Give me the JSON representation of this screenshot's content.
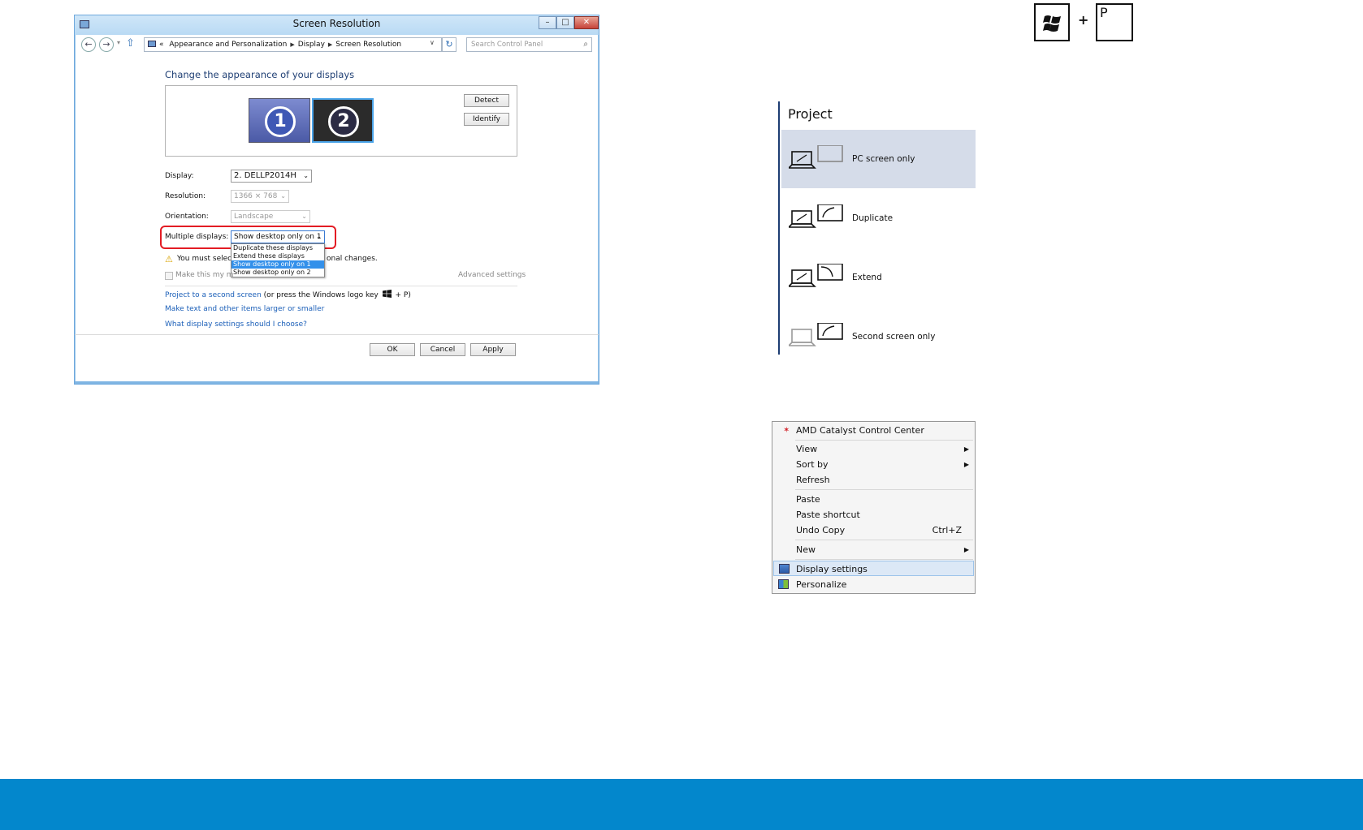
{
  "window": {
    "title": "Screen Resolution",
    "controls": {
      "minimize": "–",
      "maximize": "□",
      "close": "✕"
    },
    "address": {
      "prefix": "«",
      "crumbs": [
        "Appearance and Personalization",
        "Display",
        "Screen Resolution"
      ],
      "separator": "▶"
    },
    "search_placeholder": "Search Control Panel",
    "heading": "Change the appearance of your displays",
    "monitors": [
      "1",
      "2"
    ],
    "detect_label": "Detect",
    "identify_label": "Identify",
    "display_label": "Display:",
    "display_value": "2. DELLP2014H",
    "resolution_label": "Resolution:",
    "resolution_value": "1366 × 768",
    "orientation_label": "Orientation:",
    "orientation_value": "Landscape",
    "multiple_label": "Multiple displays:",
    "multiple_value": "Show desktop only on 1",
    "dropdown_options": [
      "Duplicate these displays",
      "Extend these displays",
      "Show desktop only on 1",
      "Show desktop only on 2"
    ],
    "warning_start": "You must select",
    "warning_end": "onal changes.",
    "checkbox_label": "Make this my m",
    "advanced_link": "Advanced settings",
    "link1_blue": "Project to a second screen",
    "link1_black_a": " (or press the Windows logo key ",
    "link1_black_b": " + P)",
    "link2": "Make text and other items larger or smaller",
    "link3": "What display settings should I choose?",
    "ok_label": "OK",
    "cancel_label": "Cancel",
    "apply_label": "Apply"
  },
  "keys": {
    "plus": "+",
    "p": "P"
  },
  "project": {
    "title": "Project",
    "items": [
      "PC screen only",
      "Duplicate",
      "Extend",
      "Second screen only"
    ],
    "active_index": 0
  },
  "context_menu": {
    "items": [
      {
        "label": "AMD Catalyst Control Center"
      },
      {
        "label": "View",
        "arrow": "▶"
      },
      {
        "label": "Sort by",
        "arrow": "▶"
      },
      {
        "label": "Refresh"
      },
      {
        "label": "Paste"
      },
      {
        "label": "Paste shortcut"
      },
      {
        "label": "Undo Copy",
        "shortcut": "Ctrl+Z"
      },
      {
        "label": "New",
        "arrow": "▶"
      },
      {
        "label": "Display settings"
      },
      {
        "label": "Personalize"
      }
    ],
    "highlighted": "Display settings"
  },
  "colors": {
    "footer": "#0387cc",
    "highlight_box": "#e31c24",
    "link": "#1b5fb8"
  }
}
